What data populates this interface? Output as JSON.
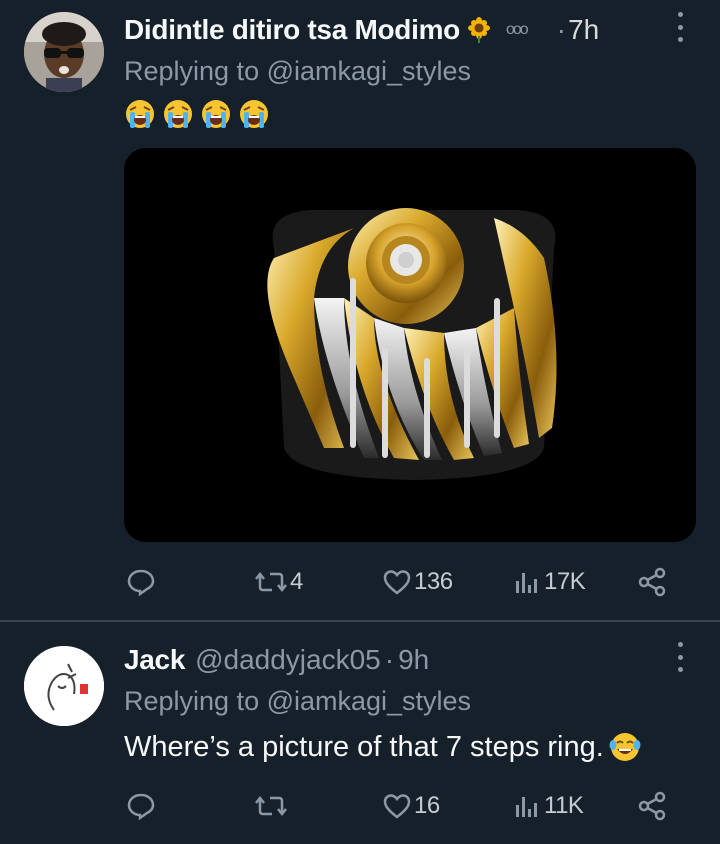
{
  "tweets": [
    {
      "author_name": "Didintle ditiro tsa Modimo",
      "name_badge_icon": "sunflower-icon",
      "extra": "ooo",
      "separator": "·",
      "time": "7h",
      "replying_to": "Replying to @iamkagi_styles",
      "text_emojis": [
        "loudly-crying-face-icon",
        "loudly-crying-face-icon",
        "loudly-crying-face-icon",
        "loudly-crying-face-icon"
      ],
      "media": "gold-and-diamond-ring-photo",
      "actions": {
        "replies": "",
        "retweets": "4",
        "likes": "136",
        "views": "17K"
      }
    },
    {
      "author_name": "Jack",
      "handle": "@daddyjack05",
      "separator": "·",
      "time": "9h",
      "replying_to": "Replying to @iamkagi_styles",
      "text": "Where’s a picture of that 7 steps ring.",
      "text_emoji": "face-with-tears-of-joy-icon",
      "actions": {
        "replies": "",
        "retweets": "",
        "likes": "16",
        "views": "11K"
      }
    }
  ],
  "colors": {
    "background": "#15202b",
    "text": "#f7f9f9",
    "muted": "#8b98a5",
    "divider": "#38444d"
  }
}
